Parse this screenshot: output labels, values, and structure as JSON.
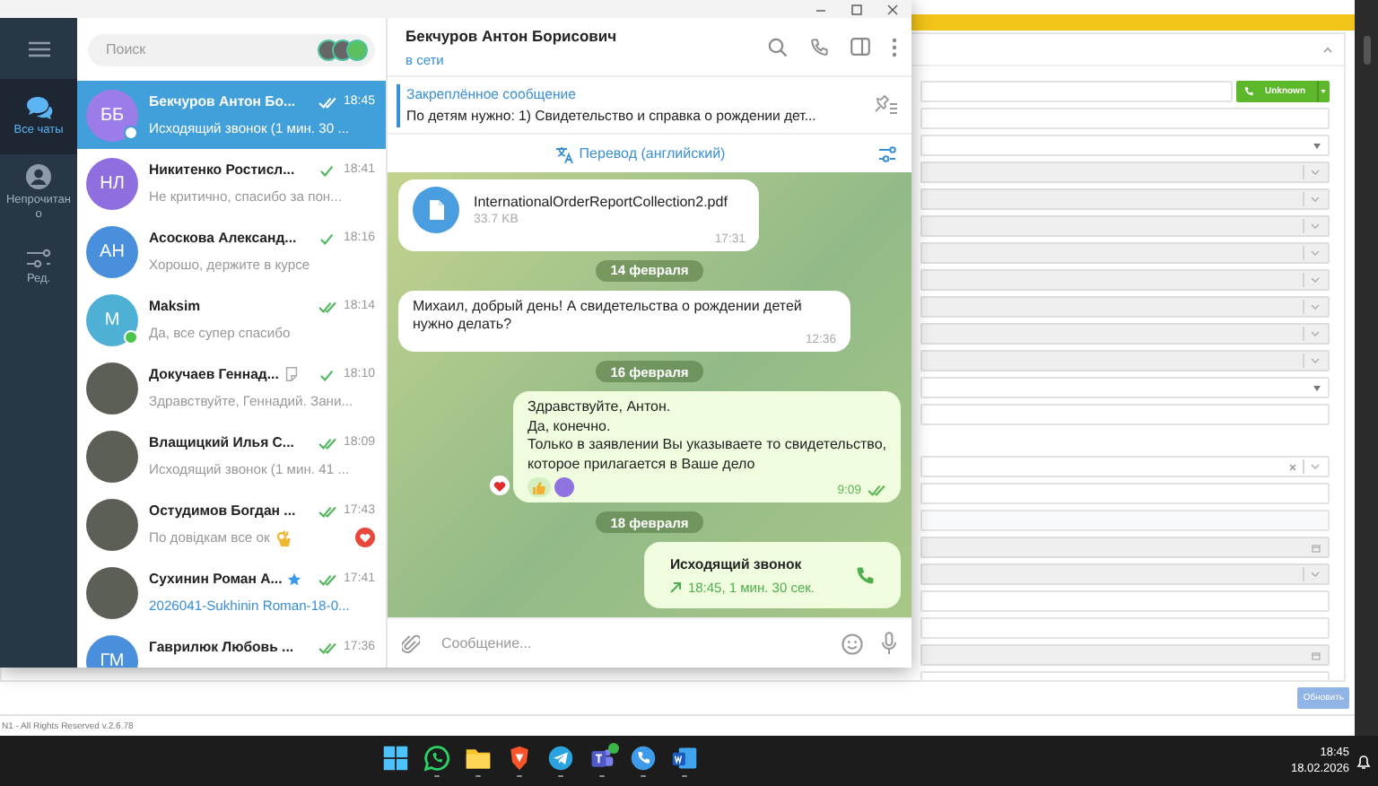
{
  "sidebar": {
    "folders": [
      {
        "label": "Все чаты",
        "selected": true
      },
      {
        "label": "Непрочитано",
        "selected": false
      },
      {
        "label": "Ред.",
        "selected": false
      }
    ]
  },
  "search": {
    "placeholder": "Поиск"
  },
  "chats": [
    {
      "name": "Бекчуров Антон Бо...",
      "time": "18:45",
      "preview": "Исходящий звонок (1 мин. 30 ...",
      "avatar": {
        "kind": "initials",
        "text": "ББ",
        "color": "#9b7ce8"
      },
      "read": true,
      "online": true,
      "reaction": false,
      "selected": true
    },
    {
      "name": "Никитенко Ростисл...",
      "time": "18:41",
      "preview": "Не критично, спасибо за пон...",
      "avatar": {
        "kind": "initials",
        "text": "НЛ",
        "color": "#8f6fe0"
      },
      "read": false,
      "online": false,
      "reaction": false,
      "selected": false
    },
    {
      "name": "Асоскова Александ...",
      "time": "18:16",
      "preview": "Хорошо, держите в курсе",
      "avatar": {
        "kind": "initials",
        "text": "АН",
        "color": "#4a8fdb"
      },
      "read": false,
      "online": false,
      "reaction": false,
      "selected": false
    },
    {
      "name": "Maksim",
      "time": "18:14",
      "preview": "Да, все супер спасибо",
      "avatar": {
        "kind": "initials",
        "text": "M",
        "color": "#4fb0d6"
      },
      "read": true,
      "online": true,
      "reaction": false,
      "selected": false
    },
    {
      "name": "Докучаев Геннад...",
      "time": "18:10",
      "preview": "Здравствуйте, Геннадий. Зани...",
      "avatar": {
        "kind": "photo"
      },
      "status_icon": true,
      "read": false,
      "online": false,
      "reaction": false,
      "selected": false
    },
    {
      "name": "Влащицкий Илья С...",
      "time": "18:09",
      "preview": "Исходящий звонок (1 мин. 41 ...",
      "avatar": {
        "kind": "photo"
      },
      "read": true,
      "online": false,
      "reaction": false,
      "selected": false
    },
    {
      "name": "Остудимов Богдан ...",
      "time": "17:43",
      "preview": "По довідкам все ок",
      "emoji": true,
      "avatar": {
        "kind": "photo"
      },
      "read": true,
      "online": false,
      "reaction": true,
      "selected": false
    },
    {
      "name": "Сухинин Роман А...",
      "time": "17:41",
      "preview": "2026041-Sukhinin Roman-18-0...",
      "attachment": true,
      "avatar": {
        "kind": "photo"
      },
      "premium": true,
      "read": true,
      "online": false,
      "reaction": false,
      "selected": false
    },
    {
      "name": "Гаврилюк Любовь ...",
      "time": "17:36",
      "avatar": {
        "kind": "initials",
        "text": "ГМ",
        "color": "#4a8fdb"
      },
      "read": true,
      "online": false,
      "reaction": false,
      "selected": false
    }
  ],
  "chat_header": {
    "name": "Бекчуров Антон Борисович",
    "status": "в сети"
  },
  "pinned": {
    "title": "Закреплённое сообщение",
    "text": "По детям нужно:  1) Свидетельство и справка о рождении дет..."
  },
  "translate": {
    "label": "Перевод (английский)"
  },
  "messages": [
    {
      "kind": "file",
      "outgoing": false,
      "file_name": "InternationalOrderReportCollection2.pdf",
      "size": "33.7 KB",
      "time": "17:31"
    },
    {
      "kind": "date",
      "text": "14 февраля"
    },
    {
      "kind": "text",
      "outgoing": false,
      "text": "Михаил, добрый день! А свидетельства о рождении детей нужно делать?",
      "time": "12:36"
    },
    {
      "kind": "date",
      "text": "16 февраля"
    },
    {
      "kind": "text",
      "outgoing": true,
      "text": "Здравствуйте, Антон.\nДа, конечно.\nТолько в заявлении Вы указываете то свидетельство,\nкоторое прилагается в Ваше дело",
      "time": "9:09",
      "read": true,
      "reactions": [
        {
          "kind": "thumbs"
        },
        {
          "kind": "avatar"
        }
      ],
      "side_reaction": true
    },
    {
      "kind": "date",
      "text": "18 февраля"
    },
    {
      "kind": "call",
      "outgoing": true,
      "title": "Исходящий звонок",
      "detail": "18:45, 1 мин. 30 сек."
    }
  ],
  "composer": {
    "placeholder": "Сообщение..."
  },
  "background_page": {
    "call_button": {
      "label": "Unknown"
    },
    "fields_top": [
      {
        "kind": "text"
      },
      {
        "kind": "select"
      },
      {
        "kind": "locked"
      },
      {
        "kind": "locked"
      },
      {
        "kind": "locked"
      },
      {
        "kind": "locked"
      },
      {
        "kind": "locked"
      },
      {
        "kind": "locked"
      },
      {
        "kind": "locked"
      },
      {
        "kind": "locked"
      },
      {
        "kind": "select"
      },
      {
        "kind": "text"
      }
    ],
    "fields_bottom": [
      {
        "kind": "clearable"
      },
      {
        "kind": "text"
      },
      {
        "kind": "shaded"
      },
      {
        "kind": "date"
      },
      {
        "kind": "locked"
      },
      {
        "kind": "text"
      },
      {
        "kind": "text"
      },
      {
        "kind": "date"
      },
      {
        "kind": "text"
      }
    ],
    "submit": "Обновить",
    "footer": "N1 - All Rights Reserved v.2.6.78"
  },
  "taskbar": {
    "apps": [
      {
        "kind": "start",
        "running": false
      },
      {
        "kind": "whatsapp",
        "running": true
      },
      {
        "kind": "files",
        "running": true
      },
      {
        "kind": "brave",
        "running": true
      },
      {
        "kind": "telegram",
        "running": true
      },
      {
        "kind": "teams",
        "running": true,
        "badge": true
      },
      {
        "kind": "phone",
        "running": true
      },
      {
        "kind": "word",
        "running": true
      }
    ],
    "time": "18:45",
    "date": "18.02.2026"
  }
}
